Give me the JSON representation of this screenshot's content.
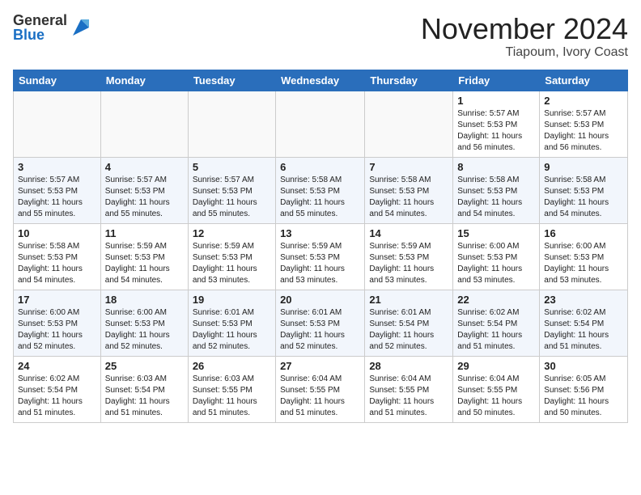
{
  "header": {
    "logo_general": "General",
    "logo_blue": "Blue",
    "month_title": "November 2024",
    "location": "Tiapoum, Ivory Coast"
  },
  "calendar": {
    "days_of_week": [
      "Sunday",
      "Monday",
      "Tuesday",
      "Wednesday",
      "Thursday",
      "Friday",
      "Saturday"
    ],
    "weeks": [
      [
        {
          "day": "",
          "info": ""
        },
        {
          "day": "",
          "info": ""
        },
        {
          "day": "",
          "info": ""
        },
        {
          "day": "",
          "info": ""
        },
        {
          "day": "",
          "info": ""
        },
        {
          "day": "1",
          "info": "Sunrise: 5:57 AM\nSunset: 5:53 PM\nDaylight: 11 hours\nand 56 minutes."
        },
        {
          "day": "2",
          "info": "Sunrise: 5:57 AM\nSunset: 5:53 PM\nDaylight: 11 hours\nand 56 minutes."
        }
      ],
      [
        {
          "day": "3",
          "info": "Sunrise: 5:57 AM\nSunset: 5:53 PM\nDaylight: 11 hours\nand 55 minutes."
        },
        {
          "day": "4",
          "info": "Sunrise: 5:57 AM\nSunset: 5:53 PM\nDaylight: 11 hours\nand 55 minutes."
        },
        {
          "day": "5",
          "info": "Sunrise: 5:57 AM\nSunset: 5:53 PM\nDaylight: 11 hours\nand 55 minutes."
        },
        {
          "day": "6",
          "info": "Sunrise: 5:58 AM\nSunset: 5:53 PM\nDaylight: 11 hours\nand 55 minutes."
        },
        {
          "day": "7",
          "info": "Sunrise: 5:58 AM\nSunset: 5:53 PM\nDaylight: 11 hours\nand 54 minutes."
        },
        {
          "day": "8",
          "info": "Sunrise: 5:58 AM\nSunset: 5:53 PM\nDaylight: 11 hours\nand 54 minutes."
        },
        {
          "day": "9",
          "info": "Sunrise: 5:58 AM\nSunset: 5:53 PM\nDaylight: 11 hours\nand 54 minutes."
        }
      ],
      [
        {
          "day": "10",
          "info": "Sunrise: 5:58 AM\nSunset: 5:53 PM\nDaylight: 11 hours\nand 54 minutes."
        },
        {
          "day": "11",
          "info": "Sunrise: 5:59 AM\nSunset: 5:53 PM\nDaylight: 11 hours\nand 54 minutes."
        },
        {
          "day": "12",
          "info": "Sunrise: 5:59 AM\nSunset: 5:53 PM\nDaylight: 11 hours\nand 53 minutes."
        },
        {
          "day": "13",
          "info": "Sunrise: 5:59 AM\nSunset: 5:53 PM\nDaylight: 11 hours\nand 53 minutes."
        },
        {
          "day": "14",
          "info": "Sunrise: 5:59 AM\nSunset: 5:53 PM\nDaylight: 11 hours\nand 53 minutes."
        },
        {
          "day": "15",
          "info": "Sunrise: 6:00 AM\nSunset: 5:53 PM\nDaylight: 11 hours\nand 53 minutes."
        },
        {
          "day": "16",
          "info": "Sunrise: 6:00 AM\nSunset: 5:53 PM\nDaylight: 11 hours\nand 53 minutes."
        }
      ],
      [
        {
          "day": "17",
          "info": "Sunrise: 6:00 AM\nSunset: 5:53 PM\nDaylight: 11 hours\nand 52 minutes."
        },
        {
          "day": "18",
          "info": "Sunrise: 6:00 AM\nSunset: 5:53 PM\nDaylight: 11 hours\nand 52 minutes."
        },
        {
          "day": "19",
          "info": "Sunrise: 6:01 AM\nSunset: 5:53 PM\nDaylight: 11 hours\nand 52 minutes."
        },
        {
          "day": "20",
          "info": "Sunrise: 6:01 AM\nSunset: 5:53 PM\nDaylight: 11 hours\nand 52 minutes."
        },
        {
          "day": "21",
          "info": "Sunrise: 6:01 AM\nSunset: 5:54 PM\nDaylight: 11 hours\nand 52 minutes."
        },
        {
          "day": "22",
          "info": "Sunrise: 6:02 AM\nSunset: 5:54 PM\nDaylight: 11 hours\nand 51 minutes."
        },
        {
          "day": "23",
          "info": "Sunrise: 6:02 AM\nSunset: 5:54 PM\nDaylight: 11 hours\nand 51 minutes."
        }
      ],
      [
        {
          "day": "24",
          "info": "Sunrise: 6:02 AM\nSunset: 5:54 PM\nDaylight: 11 hours\nand 51 minutes."
        },
        {
          "day": "25",
          "info": "Sunrise: 6:03 AM\nSunset: 5:54 PM\nDaylight: 11 hours\nand 51 minutes."
        },
        {
          "day": "26",
          "info": "Sunrise: 6:03 AM\nSunset: 5:55 PM\nDaylight: 11 hours\nand 51 minutes."
        },
        {
          "day": "27",
          "info": "Sunrise: 6:04 AM\nSunset: 5:55 PM\nDaylight: 11 hours\nand 51 minutes."
        },
        {
          "day": "28",
          "info": "Sunrise: 6:04 AM\nSunset: 5:55 PM\nDaylight: 11 hours\nand 51 minutes."
        },
        {
          "day": "29",
          "info": "Sunrise: 6:04 AM\nSunset: 5:55 PM\nDaylight: 11 hours\nand 50 minutes."
        },
        {
          "day": "30",
          "info": "Sunrise: 6:05 AM\nSunset: 5:56 PM\nDaylight: 11 hours\nand 50 minutes."
        }
      ]
    ]
  }
}
